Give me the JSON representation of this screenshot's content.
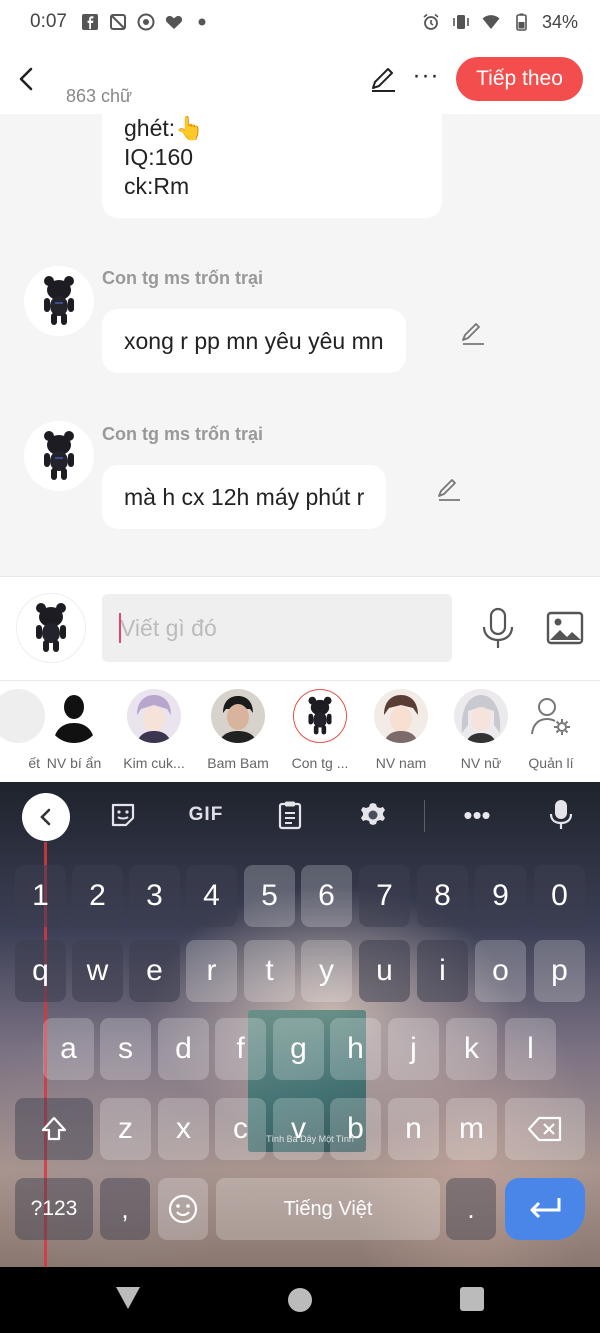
{
  "status_bar": {
    "time": "0:07",
    "battery": "34%",
    "icons": [
      "facebook-icon",
      "signal-off-icon",
      "vpn-icon",
      "heart-icon",
      "dot-icon",
      "alarm-icon",
      "vibrate-icon",
      "wifi-icon",
      "battery-icon"
    ]
  },
  "header": {
    "char_count": "863 chữ",
    "next_label": "Tiếp theo"
  },
  "chat": {
    "top_message_lines": [
      "ghét:👆",
      "IQ:160",
      "ck:Rm"
    ],
    "messages": [
      {
        "sender": "Con tg ms trốn trại",
        "text": "xong r pp mn yêu yêu mn"
      },
      {
        "sender": "Con tg ms trốn trại",
        "text": "mà h cx 12h máy phút r"
      }
    ]
  },
  "input": {
    "placeholder": "Viết gì đó",
    "value": ""
  },
  "characters": [
    {
      "label": "ết"
    },
    {
      "label": "NV bí ẩn"
    },
    {
      "label": "Kim cuk..."
    },
    {
      "label": "Bam Bam"
    },
    {
      "label": "Con tg ..."
    },
    {
      "label": "NV nam"
    },
    {
      "label": "NV nữ"
    },
    {
      "label": "Quản lí"
    }
  ],
  "keyboard": {
    "toolbar_gif": "GIF",
    "row_numbers": [
      "1",
      "2",
      "3",
      "4",
      "5",
      "6",
      "7",
      "8",
      "9",
      "0"
    ],
    "row1": [
      "q",
      "w",
      "e",
      "r",
      "t",
      "y",
      "u",
      "i",
      "o",
      "p"
    ],
    "row2": [
      "a",
      "s",
      "d",
      "f",
      "g",
      "h",
      "j",
      "k",
      "l"
    ],
    "row3": [
      "z",
      "x",
      "c",
      "v",
      "b",
      "n",
      "m"
    ],
    "symbols_label": "?123",
    "comma": ",",
    "space_label": "Tiếng Việt",
    "period": ".",
    "album_text": "Tình Bá Dây Một Tình"
  },
  "colors": {
    "accent": "#f34d4d",
    "enter_key": "#4a86e8"
  }
}
